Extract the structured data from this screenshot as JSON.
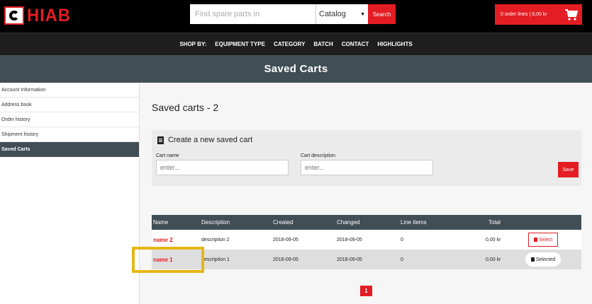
{
  "header": {
    "logo_text": "HIAB",
    "search_placeholder": "Find spare parts in",
    "catalog_label": "Catalog",
    "search_button": "Search",
    "cart_summary": "0 order lines | 0,00 kr"
  },
  "nav": {
    "items": [
      "SHOP BY:",
      "EQUIPMENT TYPE",
      "CATEGORY",
      "BATCH",
      "CONTACT",
      "HIGHLIGHTS"
    ]
  },
  "page_title": "Saved Carts",
  "sidebar": {
    "items": [
      {
        "label": "Account Information"
      },
      {
        "label": "Address book"
      },
      {
        "label": "Order history"
      },
      {
        "label": "Shipment history"
      },
      {
        "label": "Saved Carts"
      }
    ]
  },
  "main": {
    "heading": "Saved carts - 2",
    "create": {
      "title": "Create a new saved cart",
      "name_label": "Cart name",
      "name_placeholder": "enter...",
      "desc_label": "Cart description",
      "desc_placeholder": "enter...",
      "save_label": "Save"
    },
    "table": {
      "headers": [
        "Name",
        "Description",
        "Created",
        "Changed",
        "Line items",
        "Total"
      ],
      "rows": [
        {
          "name": "name 2",
          "description": "description 2",
          "created": "2018-09-05",
          "changed": "2018-09-05",
          "line_items": "0",
          "total": "0,00 kr",
          "action": "Select"
        },
        {
          "name": "name 1",
          "description": "escription 1",
          "created": "2018-09-05",
          "changed": "2018-09-05",
          "line_items": "0",
          "total": "0,00 kr",
          "action": "Selected"
        }
      ]
    },
    "pagination": {
      "current": "1"
    }
  },
  "colors": {
    "brand_red": "#e31d23",
    "header_dark": "#414e56",
    "highlight": "#e6b817"
  },
  "icons": [
    "hiab-logo-icon",
    "cart-icon",
    "caret-down-icon",
    "document-icon"
  ]
}
